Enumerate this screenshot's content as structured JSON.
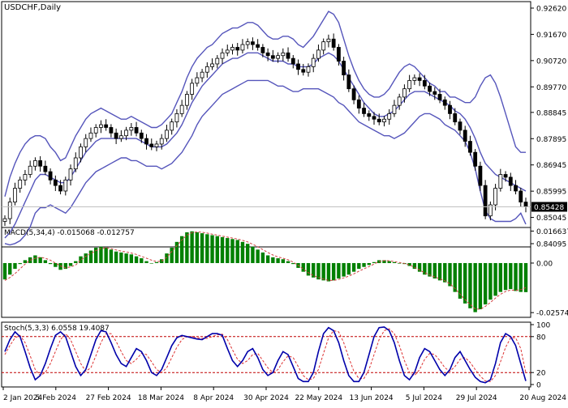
{
  "chart_data": {
    "type": "candlestick",
    "symbol": "USDCHF,Daily",
    "x_labels": [
      "2 Jan 2024",
      "5 Feb 2024",
      "27 Feb 2024",
      "18 Mar 2024",
      "8 Apr 2024",
      "30 Apr 2024",
      "22 May 2024",
      "13 Jun 2024",
      "5 Jul 2024",
      "29 Jul 2024",
      "20 Aug 2024"
    ],
    "price_ticks": [
      "0.92620",
      "0.91670",
      "0.90720",
      "0.89770",
      "0.88845",
      "0.87895",
      "0.86945",
      "0.85995",
      "0.85045",
      "0.84095"
    ],
    "ylim": [
      0.84095,
      0.9262
    ],
    "current_price": "0.85428",
    "close": [
      0.85,
      0.856,
      0.861,
      0.864,
      0.866,
      0.869,
      0.871,
      0.869,
      0.867,
      0.864,
      0.862,
      0.86,
      0.864,
      0.868,
      0.872,
      0.876,
      0.879,
      0.881,
      0.883,
      0.884,
      0.883,
      0.881,
      0.879,
      0.88,
      0.882,
      0.883,
      0.881,
      0.879,
      0.877,
      0.876,
      0.877,
      0.879,
      0.882,
      0.885,
      0.888,
      0.891,
      0.895,
      0.899,
      0.901,
      0.903,
      0.905,
      0.906,
      0.908,
      0.91,
      0.911,
      0.912,
      0.911,
      0.913,
      0.914,
      0.913,
      0.912,
      0.91,
      0.909,
      0.908,
      0.909,
      0.91,
      0.908,
      0.906,
      0.904,
      0.903,
      0.905,
      0.908,
      0.911,
      0.914,
      0.915,
      0.912,
      0.907,
      0.902,
      0.897,
      0.893,
      0.89,
      0.888,
      0.887,
      0.886,
      0.885,
      0.886,
      0.888,
      0.891,
      0.894,
      0.897,
      0.9,
      0.901,
      0.9,
      0.898,
      0.896,
      0.895,
      0.893,
      0.891,
      0.888,
      0.885,
      0.882,
      0.878,
      0.874,
      0.869,
      0.862,
      0.851,
      0.855,
      0.861,
      0.866,
      0.865,
      0.862,
      0.86,
      0.856,
      0.8543
    ],
    "bollinger": {
      "upper": [
        0.858,
        0.865,
        0.87,
        0.874,
        0.877,
        0.879,
        0.88,
        0.88,
        0.879,
        0.876,
        0.874,
        0.871,
        0.872,
        0.876,
        0.88,
        0.883,
        0.886,
        0.888,
        0.889,
        0.89,
        0.889,
        0.888,
        0.887,
        0.886,
        0.886,
        0.887,
        0.886,
        0.885,
        0.884,
        0.883,
        0.883,
        0.884,
        0.886,
        0.888,
        0.892,
        0.896,
        0.901,
        0.905,
        0.908,
        0.91,
        0.912,
        0.913,
        0.915,
        0.917,
        0.918,
        0.919,
        0.919,
        0.92,
        0.921,
        0.921,
        0.92,
        0.918,
        0.916,
        0.915,
        0.915,
        0.916,
        0.916,
        0.915,
        0.913,
        0.912,
        0.914,
        0.916,
        0.919,
        0.922,
        0.925,
        0.924,
        0.921,
        0.915,
        0.909,
        0.904,
        0.9,
        0.897,
        0.895,
        0.894,
        0.894,
        0.895,
        0.897,
        0.9,
        0.903,
        0.905,
        0.906,
        0.905,
        0.903,
        0.901,
        0.899,
        0.898,
        0.896,
        0.896,
        0.894,
        0.894,
        0.893,
        0.892,
        0.892,
        0.894,
        0.898,
        0.901,
        0.902,
        0.899,
        0.894,
        0.888,
        0.882,
        0.876,
        0.874,
        0.874
      ],
      "middle": [
        0.843,
        0.845,
        0.848,
        0.852,
        0.856,
        0.86,
        0.864,
        0.866,
        0.866,
        0.865,
        0.864,
        0.863,
        0.863,
        0.865,
        0.868,
        0.871,
        0.874,
        0.876,
        0.878,
        0.879,
        0.879,
        0.879,
        0.879,
        0.879,
        0.879,
        0.879,
        0.879,
        0.878,
        0.877,
        0.876,
        0.876,
        0.876,
        0.877,
        0.879,
        0.881,
        0.884,
        0.888,
        0.892,
        0.895,
        0.898,
        0.9,
        0.902,
        0.904,
        0.906,
        0.907,
        0.908,
        0.908,
        0.909,
        0.91,
        0.91,
        0.91,
        0.909,
        0.908,
        0.907,
        0.907,
        0.907,
        0.906,
        0.906,
        0.905,
        0.905,
        0.905,
        0.906,
        0.908,
        0.909,
        0.91,
        0.909,
        0.907,
        0.904,
        0.901,
        0.898,
        0.895,
        0.892,
        0.89,
        0.888,
        0.887,
        0.887,
        0.888,
        0.889,
        0.891,
        0.893,
        0.895,
        0.896,
        0.896,
        0.896,
        0.895,
        0.894,
        0.893,
        0.892,
        0.891,
        0.889,
        0.888,
        0.886,
        0.883,
        0.879,
        0.874,
        0.87,
        0.868,
        0.866,
        0.865,
        0.864,
        0.863,
        0.862,
        0.861,
        0.86
      ],
      "lower": [
        0.841,
        0.8405,
        0.841,
        0.842,
        0.844,
        0.847,
        0.852,
        0.854,
        0.854,
        0.855,
        0.854,
        0.853,
        0.852,
        0.854,
        0.857,
        0.86,
        0.863,
        0.865,
        0.867,
        0.868,
        0.869,
        0.87,
        0.871,
        0.872,
        0.872,
        0.871,
        0.871,
        0.87,
        0.869,
        0.869,
        0.869,
        0.868,
        0.869,
        0.87,
        0.872,
        0.874,
        0.877,
        0.88,
        0.884,
        0.887,
        0.889,
        0.891,
        0.893,
        0.895,
        0.896,
        0.897,
        0.898,
        0.899,
        0.9,
        0.9,
        0.9,
        0.9,
        0.9,
        0.899,
        0.898,
        0.898,
        0.897,
        0.896,
        0.896,
        0.897,
        0.897,
        0.897,
        0.897,
        0.896,
        0.895,
        0.894,
        0.892,
        0.891,
        0.889,
        0.887,
        0.885,
        0.884,
        0.883,
        0.882,
        0.881,
        0.88,
        0.88,
        0.879,
        0.88,
        0.881,
        0.883,
        0.885,
        0.887,
        0.888,
        0.888,
        0.887,
        0.886,
        0.884,
        0.883,
        0.882,
        0.88,
        0.878,
        0.874,
        0.868,
        0.86,
        0.853,
        0.85,
        0.849,
        0.849,
        0.849,
        0.849,
        0.85,
        0.852,
        0.848
      ]
    },
    "macd": {
      "label": "MACD(5,34,4) -0.015068 -0.012757",
      "ticks": [
        "0.016637",
        "0.00",
        "-0.025749"
      ],
      "ylim": [
        -0.0282,
        0.0185
      ],
      "histogram": [
        -0.0085,
        -0.006,
        -0.003,
        -0.0005,
        0.0015,
        0.003,
        0.004,
        0.003,
        0.0015,
        -0.0005,
        -0.002,
        -0.0035,
        -0.003,
        -0.0015,
        0.001,
        0.0035,
        0.005,
        0.0065,
        0.008,
        0.0085,
        0.008,
        0.007,
        0.006,
        0.0055,
        0.005,
        0.0045,
        0.0035,
        0.0025,
        0.001,
        0.0,
        0.0005,
        0.002,
        0.005,
        0.008,
        0.011,
        0.014,
        0.016,
        0.0165,
        0.016,
        0.0155,
        0.015,
        0.0145,
        0.014,
        0.0135,
        0.013,
        0.0125,
        0.012,
        0.011,
        0.01,
        0.0085,
        0.007,
        0.0055,
        0.004,
        0.003,
        0.0025,
        0.002,
        0.001,
        -0.0005,
        -0.0025,
        -0.0045,
        -0.0065,
        -0.0075,
        -0.0085,
        -0.009,
        -0.0095,
        -0.009,
        -0.008,
        -0.007,
        -0.006,
        -0.0045,
        -0.003,
        -0.002,
        -0.001,
        0.0005,
        0.0015,
        0.0015,
        0.001,
        0.0005,
        0.0,
        -0.0005,
        -0.0015,
        -0.003,
        -0.0045,
        -0.006,
        -0.007,
        -0.008,
        -0.009,
        -0.01,
        -0.012,
        -0.015,
        -0.0185,
        -0.021,
        -0.0235,
        -0.0255,
        -0.024,
        -0.0215,
        -0.019,
        -0.017,
        -0.015,
        -0.014,
        -0.0135,
        -0.0145,
        -0.015,
        -0.0151
      ],
      "signal": [
        -0.009,
        -0.0075,
        -0.0055,
        -0.003,
        -0.0005,
        0.0015,
        0.0025,
        0.003,
        0.0025,
        0.0015,
        0.0,
        -0.0015,
        -0.0025,
        -0.002,
        -0.001,
        0.0015,
        0.0035,
        0.005,
        0.0065,
        0.0075,
        0.008,
        0.0075,
        0.0068,
        0.0062,
        0.0058,
        0.0052,
        0.0045,
        0.0035,
        0.0025,
        0.0015,
        0.0008,
        0.001,
        0.003,
        0.006,
        0.009,
        0.012,
        0.0145,
        0.0158,
        0.0162,
        0.016,
        0.0156,
        0.015,
        0.0145,
        0.014,
        0.0135,
        0.013,
        0.0125,
        0.0118,
        0.011,
        0.0098,
        0.0085,
        0.007,
        0.0055,
        0.0042,
        0.0032,
        0.0025,
        0.0017,
        0.0005,
        -0.0012,
        -0.003,
        -0.005,
        -0.0065,
        -0.0075,
        -0.0083,
        -0.009,
        -0.009,
        -0.0085,
        -0.0077,
        -0.0068,
        -0.0056,
        -0.0042,
        -0.003,
        -0.0018,
        -0.0005,
        0.0008,
        0.0013,
        0.0012,
        0.0008,
        0.0003,
        -0.0002,
        -0.001,
        -0.0022,
        -0.0036,
        -0.005,
        -0.0062,
        -0.0072,
        -0.0082,
        -0.0092,
        -0.0108,
        -0.0132,
        -0.0162,
        -0.019,
        -0.0215,
        -0.0238,
        -0.024,
        -0.0225,
        -0.0205,
        -0.0182,
        -0.0162,
        -0.0148,
        -0.014,
        -0.0142,
        -0.0138,
        -0.0128
      ]
    },
    "stoch": {
      "label": "Stoch(5,3,3) 6.0558 19.4087",
      "ticks": [
        "100",
        "80",
        "20",
        "0"
      ],
      "levels": [
        80,
        20
      ],
      "main": [
        55,
        75,
        88,
        80,
        55,
        28,
        8,
        15,
        35,
        60,
        82,
        88,
        80,
        55,
        30,
        15,
        25,
        50,
        75,
        90,
        88,
        70,
        50,
        35,
        30,
        45,
        60,
        55,
        40,
        20,
        15,
        25,
        45,
        65,
        78,
        82,
        80,
        78,
        76,
        75,
        80,
        85,
        85,
        82,
        60,
        40,
        30,
        40,
        55,
        60,
        45,
        25,
        15,
        20,
        40,
        55,
        50,
        30,
        10,
        5,
        5,
        20,
        55,
        85,
        95,
        90,
        70,
        40,
        15,
        5,
        5,
        20,
        50,
        80,
        95,
        96,
        90,
        70,
        40,
        15,
        8,
        20,
        45,
        60,
        55,
        40,
        25,
        15,
        25,
        45,
        55,
        40,
        25,
        12,
        5,
        3,
        8,
        35,
        70,
        85,
        80,
        65,
        35,
        6
      ],
      "signal": [
        50,
        65,
        78,
        82,
        70,
        48,
        25,
        15,
        20,
        35,
        55,
        75,
        85,
        75,
        55,
        35,
        22,
        28,
        48,
        70,
        85,
        85,
        72,
        55,
        40,
        35,
        42,
        52,
        50,
        38,
        25,
        20,
        28,
        45,
        62,
        75,
        80,
        80,
        78,
        77,
        77,
        80,
        83,
        84,
        75,
        58,
        42,
        35,
        40,
        50,
        52,
        40,
        28,
        20,
        25,
        38,
        48,
        45,
        30,
        15,
        8,
        10,
        25,
        52,
        78,
        90,
        88,
        70,
        45,
        22,
        10,
        10,
        25,
        50,
        75,
        90,
        93,
        85,
        65,
        40,
        20,
        15,
        25,
        42,
        52,
        50,
        40,
        28,
        22,
        30,
        42,
        45,
        37,
        25,
        14,
        6,
        5,
        15,
        38,
        62,
        78,
        78,
        60,
        19.4
      ]
    }
  }
}
